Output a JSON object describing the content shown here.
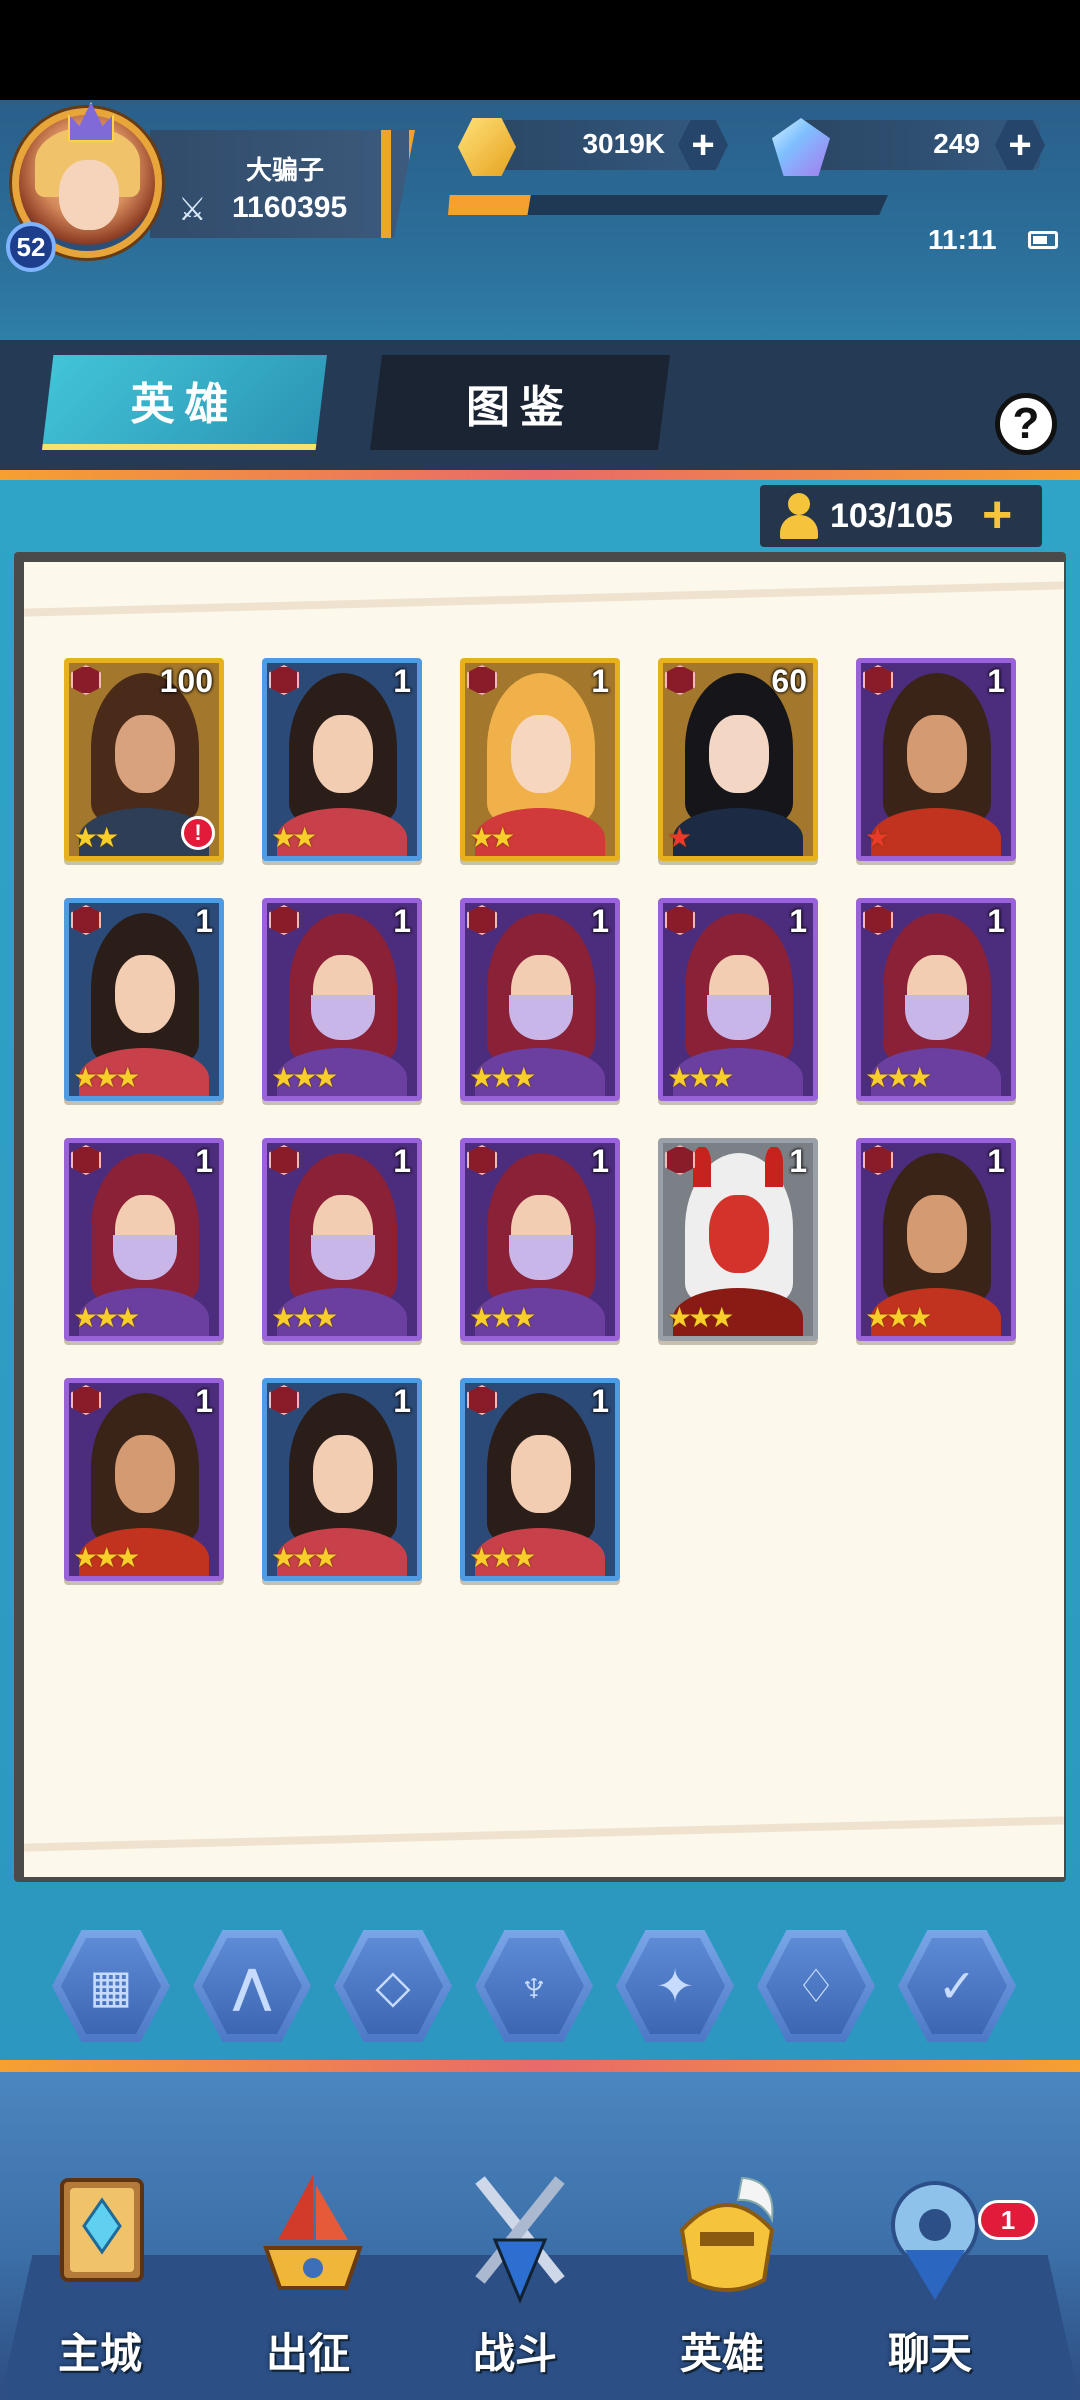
{
  "player": {
    "name": "大骗子",
    "level": "52",
    "power": "1160395",
    "exp_fraction": 0.12
  },
  "currency": {
    "gold": "3019K",
    "gems": "249"
  },
  "status": {
    "time": "11:11"
  },
  "tabs": {
    "heroes": "英雄",
    "codex": "图鉴"
  },
  "capacity": {
    "text": "103/105"
  },
  "heroes": [
    {
      "level": "100",
      "rarity": "gold",
      "stars": 2,
      "star_color": "gold",
      "type": "brawler-man",
      "alert": true
    },
    {
      "level": "1",
      "rarity": "blue",
      "stars": 2,
      "star_color": "gold",
      "type": "circlet-woman"
    },
    {
      "level": "1",
      "rarity": "gold",
      "stars": 2,
      "star_color": "gold",
      "type": "blonde-woman"
    },
    {
      "level": "60",
      "rarity": "gold",
      "stars": 1,
      "star_color": "red",
      "type": "black-hair-warrior"
    },
    {
      "level": "1",
      "rarity": "purple",
      "stars": 1,
      "star_color": "red",
      "type": "bearded-man"
    },
    {
      "level": "1",
      "rarity": "blue",
      "stars": 3,
      "star_color": "gold",
      "type": "circlet-woman"
    },
    {
      "level": "1",
      "rarity": "purple",
      "stars": 3,
      "star_color": "gold",
      "type": "veiled-woman"
    },
    {
      "level": "1",
      "rarity": "purple",
      "stars": 3,
      "star_color": "gold",
      "type": "veiled-woman"
    },
    {
      "level": "1",
      "rarity": "purple",
      "stars": 3,
      "star_color": "gold",
      "type": "veiled-woman"
    },
    {
      "level": "1",
      "rarity": "purple",
      "stars": 3,
      "star_color": "gold",
      "type": "veiled-woman"
    },
    {
      "level": "1",
      "rarity": "purple",
      "stars": 3,
      "star_color": "gold",
      "type": "veiled-woman"
    },
    {
      "level": "1",
      "rarity": "purple",
      "stars": 3,
      "star_color": "gold",
      "type": "veiled-woman"
    },
    {
      "level": "1",
      "rarity": "purple",
      "stars": 3,
      "star_color": "gold",
      "type": "veiled-woman"
    },
    {
      "level": "1",
      "rarity": "gray",
      "stars": 3,
      "star_color": "gold",
      "type": "red-demon"
    },
    {
      "level": "1",
      "rarity": "purple",
      "stars": 3,
      "star_color": "gold",
      "type": "bearded-man"
    },
    {
      "level": "1",
      "rarity": "purple",
      "stars": 3,
      "star_color": "gold",
      "type": "bearded-man"
    },
    {
      "level": "1",
      "rarity": "blue",
      "stars": 3,
      "star_color": "gold",
      "type": "circlet-woman"
    },
    {
      "level": "1",
      "rarity": "blue",
      "stars": 3,
      "star_color": "gold",
      "type": "circlet-woman"
    }
  ],
  "filters": [
    "all-filter-icon",
    "class-1-icon",
    "class-2-icon",
    "class-3-icon",
    "class-4-icon",
    "class-5-icon",
    "class-6-icon"
  ],
  "nav": {
    "city": "主城",
    "expedition": "出征",
    "battle": "战斗",
    "heroes": "英雄",
    "chat": "聊天",
    "chat_badge": "1"
  }
}
